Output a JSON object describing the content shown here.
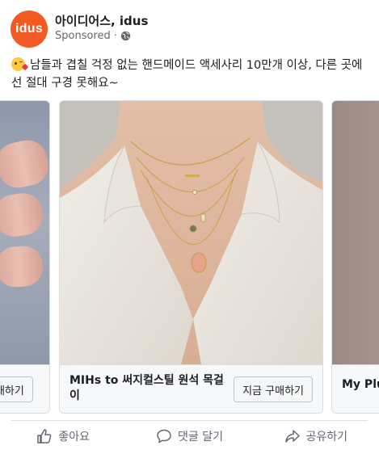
{
  "post": {
    "page_name": "아이디어스, idus",
    "logo_text": "idus",
    "sponsored_label": "Sponsored",
    "separator": "·",
    "caption": "남들과 겹칠 걱정 없는 핸드메이드 액세사리 10만개 이상, 다른 곳에선 절대 구경 못해요~"
  },
  "carousel": {
    "cards": [
      {
        "title": "",
        "cta": "구매하기"
      },
      {
        "title": "MIHs to 써지컬스틸 원석 목걸이",
        "cta": "지금 구매하기"
      },
      {
        "title": "My Plu",
        "cta": ""
      }
    ]
  },
  "actions": {
    "like": "좋아요",
    "comment": "댓글 달기",
    "share": "공유하기"
  },
  "colors": {
    "brand": "#f25a21",
    "text_secondary": "#65676b"
  }
}
